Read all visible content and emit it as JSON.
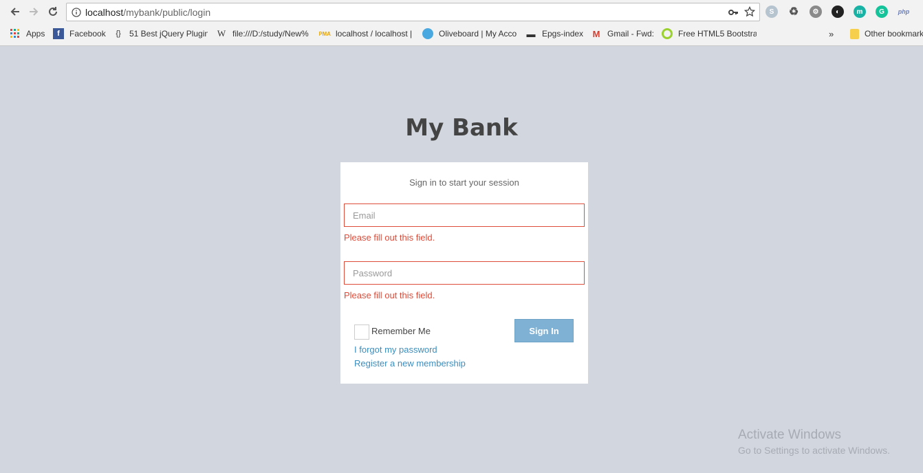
{
  "browser": {
    "url_host": "localhost",
    "url_path": "/mybank/public/login",
    "bookmarks": [
      {
        "label": "Apps",
        "icon": "apps-grid-icon"
      },
      {
        "label": "Facebook",
        "icon": "facebook-icon"
      },
      {
        "label": "51 Best jQuery Plugin",
        "icon": "braces-icon"
      },
      {
        "label": "file:///D:/study/New%",
        "icon": "wikipedia-icon"
      },
      {
        "label": "localhost / localhost |",
        "icon": "phpmyadmin-icon"
      },
      {
        "label": "Oliveboard | My Acco",
        "icon": "oliveboard-icon"
      },
      {
        "label": "Epgs-index",
        "icon": "printer-icon"
      },
      {
        "label": "Gmail - Fwd:",
        "icon": "gmail-icon"
      },
      {
        "label": "Free HTML5 Bootstra",
        "icon": "bootstrap-icon"
      }
    ],
    "more_label": "»",
    "other_bookmarks": "Other bookmarks",
    "extensions": [
      {
        "name": "skype-icon",
        "glyph": "S"
      },
      {
        "name": "recycle-icon",
        "glyph": "♻"
      },
      {
        "name": "settings-gear-icon",
        "glyph": "⚙"
      },
      {
        "name": "speedometer-icon",
        "glyph": "◐"
      },
      {
        "name": "m-icon",
        "glyph": "m"
      },
      {
        "name": "grammarly-icon",
        "glyph": "G"
      },
      {
        "name": "php-icon",
        "glyph": "php"
      }
    ]
  },
  "page": {
    "logo": "My Bank",
    "login_message": "Sign in to start your session",
    "email_placeholder": "Email",
    "email_error": "Please fill out this field.",
    "password_placeholder": "Password",
    "password_error": "Please fill out this field.",
    "remember_label": "Remember Me",
    "signin_label": "Sign In",
    "forgot_link": "I forgot my password",
    "register_link": "Register a new membership"
  },
  "watermark": {
    "line1": "Activate Windows",
    "line2": "Go to Settings to activate Windows."
  }
}
